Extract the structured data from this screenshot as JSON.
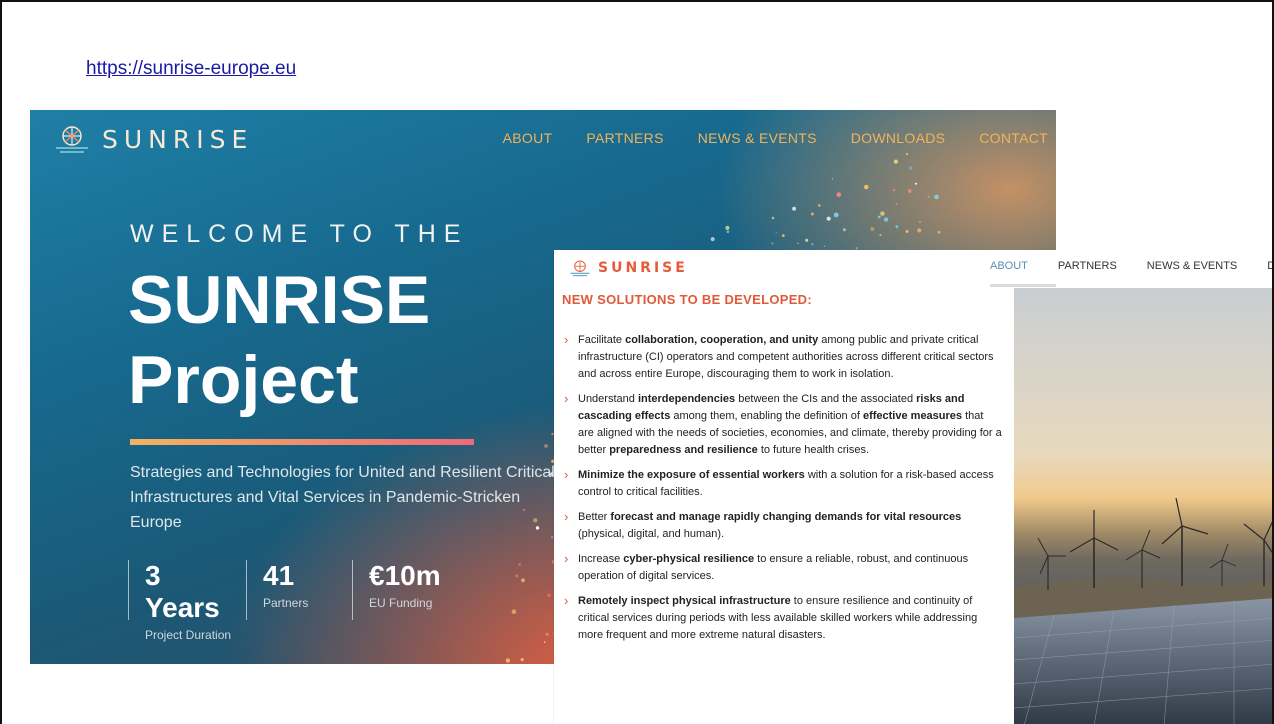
{
  "slide": {
    "url": "https://sunrise-europe.eu"
  },
  "hero": {
    "logo_text": "SUNRISE",
    "nav": [
      "ABOUT",
      "PARTNERS",
      "NEWS & EVENTS",
      "DOWNLOADS",
      "CONTACT"
    ],
    "welcome": "WELCOME TO THE",
    "title_line1": "SUNRISE",
    "title_line2": "Project",
    "subtitle": "Strategies and Technologies for United and Resilient Critical Infrastructures and Vital Services in Pandemic-Stricken Europe",
    "stats": [
      {
        "value": "3 Years",
        "label": "Project Duration"
      },
      {
        "value": "41",
        "label": "Partners"
      },
      {
        "value": "€10m",
        "label": "EU Funding"
      }
    ],
    "colors": {
      "nav": "#f2b35a",
      "accent_start": "#f4b35e",
      "accent_end": "#ee6a78"
    }
  },
  "overlay": {
    "logo_text": "SUNRISE",
    "nav": [
      "ABOUT",
      "PARTNERS",
      "NEWS & EVENTS",
      "D"
    ],
    "active_nav": "ABOUT",
    "heading": "NEW SOLUTIONS TO BE DEVELOPED:",
    "items": [
      {
        "parts": [
          [
            "Facilitate ",
            false
          ],
          [
            "collaboration, cooperation, and unity",
            true
          ],
          [
            " among public and private critical infrastructure (CI) operators and competent authorities across different critical sectors and across entire Europe, discouraging them to work in isolation.",
            false
          ]
        ]
      },
      {
        "parts": [
          [
            "Understand ",
            false
          ],
          [
            "interdependencies",
            true
          ],
          [
            " between the CIs and the associated ",
            false
          ],
          [
            "risks and cascading effects",
            true
          ],
          [
            " among them, enabling the definition of ",
            false
          ],
          [
            "effective measures",
            true
          ],
          [
            " that are aligned with the needs of societies, economies, and climate, thereby providing for a better ",
            false
          ],
          [
            "preparedness and resilience",
            true
          ],
          [
            " to future health crises.",
            false
          ]
        ]
      },
      {
        "parts": [
          [
            "Minimize the exposure of essential workers",
            true
          ],
          [
            " with a solution for a risk-based access control to critical facilities.",
            false
          ]
        ]
      },
      {
        "parts": [
          [
            "Better ",
            false
          ],
          [
            "forecast and manage rapidly changing demands for vital resources",
            true
          ],
          [
            " (physical, digital, and human).",
            false
          ]
        ]
      },
      {
        "parts": [
          [
            "Increase ",
            false
          ],
          [
            "cyber-physical resilience",
            true
          ],
          [
            " to ensure a reliable, robust, and continuous operation of digital services.",
            false
          ]
        ]
      },
      {
        "parts": [
          [
            "Remotely inspect physical infrastructure",
            true
          ],
          [
            " to ensure resilience and continuity of critical services during periods with less available skilled workers while addressing more frequent and more extreme natural disasters.",
            false
          ]
        ]
      }
    ],
    "colors": {
      "heading": "#e05a3a",
      "active_nav": "#5a8fb0"
    }
  }
}
